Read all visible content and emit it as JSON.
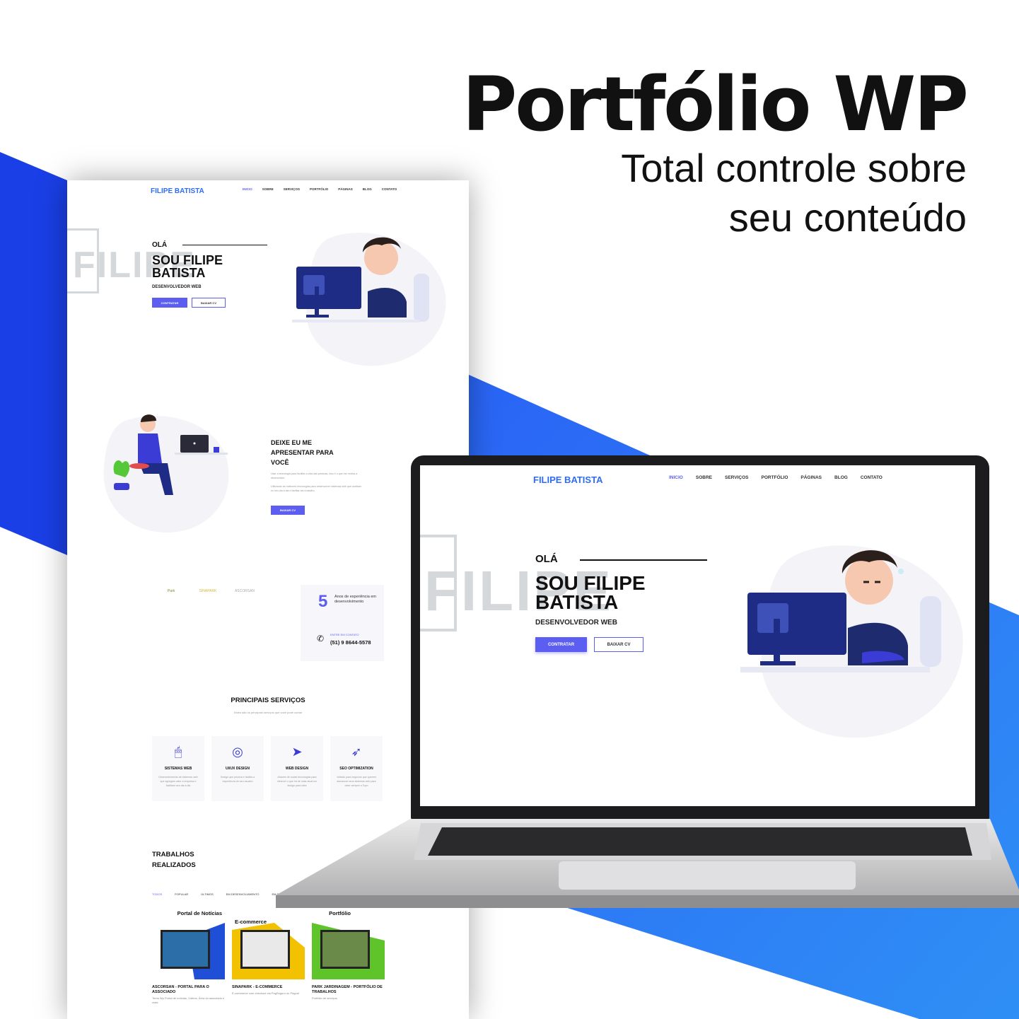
{
  "headline": {
    "title": "Portfólio WP",
    "subtitle_line1": "Total controle sobre",
    "subtitle_line2": "seu conteúdo"
  },
  "colors": {
    "brand_blue": "#2f6cf6",
    "accent_purple": "#5b5ef0",
    "navy": "#23308f",
    "bg_blue": "#1f4ff0"
  },
  "site": {
    "logo": "FILIPE BATISTA",
    "nav": [
      "INICIO",
      "SOBRE",
      "SERVIÇOS",
      "PORTFÓLIO",
      "PÁGINAS",
      "BLOG",
      "CONTATO"
    ],
    "hero": {
      "bg_word": "FILIPE",
      "greeting": "OLÁ",
      "name": "SOU FILIPE BATISTA",
      "role": "DESENVOLVEDOR WEB",
      "btn_primary": "CONTRATAR",
      "btn_secondary": "BAIXAR CV"
    },
    "about": {
      "title": "DEIXE EU ME APRESENTAR PARA VOCÊ",
      "p1": "Usar a tecnologia para facilitar a vida das pessoas, isso é o que me motiva a desenvolver.",
      "p2": "Utilizando as melhores tecnologias para desenvolver sistemas web que auxiliam no seu dia a dia e facilitar seu trabalho.",
      "button": "BAIXAR CV"
    },
    "clients": [
      "Park",
      "SINAPARK",
      "ASCORSAN"
    ],
    "experience": {
      "number": "5",
      "text": "Anos de experiência em desenvolvimento",
      "contact_label": "ENTRE EM CONTATO",
      "phone": "(51) 9 8644-5578"
    },
    "services": {
      "title": "PRINCIPAIS SERVIÇOS",
      "subtitle": "Estes são os principais serviços que você pode contar",
      "items": [
        {
          "icon": "mouse-icon",
          "title": "SISTEMAS WEB",
          "desc": "Desenvolvimento de sistemas web que agregam valor à empresa e facilitam seu dia a dia"
        },
        {
          "icon": "palette-icon",
          "title": "UI/UX DESIGN",
          "desc": "Design que prioriza e facilita a experiência do seu usuário"
        },
        {
          "icon": "paper-plane-icon",
          "title": "WEB DESIGN",
          "desc": "Através de novas tecnologias para oferecer o que há de mais atual em design para sites"
        },
        {
          "icon": "rocket-icon",
          "title": "SEO OPTIMIZATION",
          "desc": "Voltado para negócios que querem alavancar seus sistemas web para obter sempre o Topo"
        }
      ]
    },
    "works": {
      "title": "TRABALHOS REALIZADOS",
      "filters": [
        "TODOS",
        "POPULAR",
        "ÚLTIMOS",
        "EM DESENVOLVIMENTO",
        "EM BREVE"
      ],
      "items": [
        {
          "thumb_title": "Portal de Notícias",
          "name": "ASCORSAN - PORTAL PARA O ASSOCIADO",
          "desc": "Tema Wp Portal de notícias, Vídeos, Área do associado e mais"
        },
        {
          "thumb_title": "E-commerce",
          "name": "SINAPARK - E-COMMERCE",
          "desc": "E-commerce com checkout via PagSeguro ou Paypal"
        },
        {
          "thumb_title": "Portfólio",
          "name": "PARK JARDINAGEM - PORTFÓLIO DE TRABALHOS",
          "desc": "Portfólio de serviços"
        }
      ]
    }
  }
}
